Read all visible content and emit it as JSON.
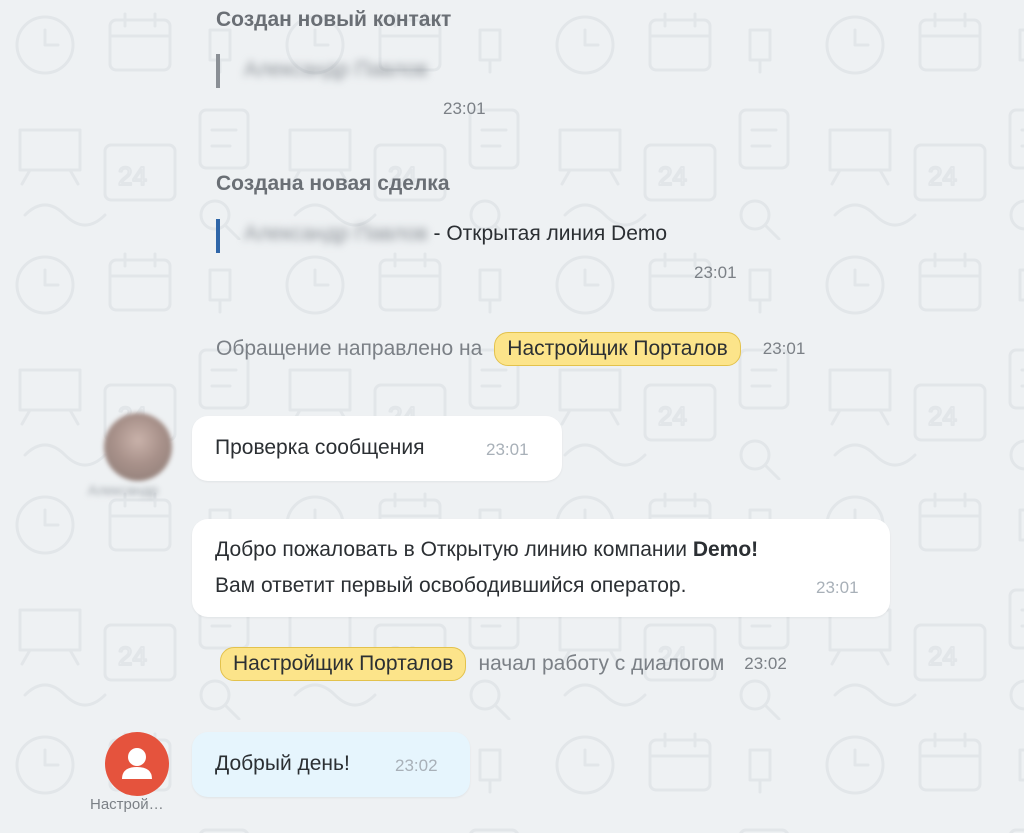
{
  "contact_event": {
    "title": "Создан новый контакт",
    "name_blurred": "Александр Павлов",
    "time": "23:01"
  },
  "deal_event": {
    "title": "Создана новая сделка",
    "name_blurred": "Александр Павлов",
    "suffix": " - Открытая линия Demo",
    "time": "23:01"
  },
  "redirect_event": {
    "text": "Обращение направлено на",
    "operator_badge": "Настройщик Порталов",
    "time": "23:01"
  },
  "client_message": {
    "text": "Проверка сообщения",
    "time": "23:01",
    "author_blurred": "Александр"
  },
  "welcome_message": {
    "line1": "Добро пожаловать в Открытую линию компании ",
    "company": "Demo!",
    "line2": "Вам ответит первый освободившийся оператор.",
    "time": "23:01"
  },
  "dialog_started_event": {
    "operator_badge": "Настройщик Порталов",
    "text": "начал работу с диалогом",
    "time": "23:02"
  },
  "operator_message": {
    "text": "Добрый день!",
    "time": "23:02",
    "author_label": "Настрой…"
  },
  "colors": {
    "background": "#eef1f3",
    "contact_bar": "#8a8f95",
    "deal_bar": "#2f66a8",
    "badge": "#fce48a",
    "operator_avatar": "#e5533d",
    "operator_bubble": "#e6f5fd"
  }
}
